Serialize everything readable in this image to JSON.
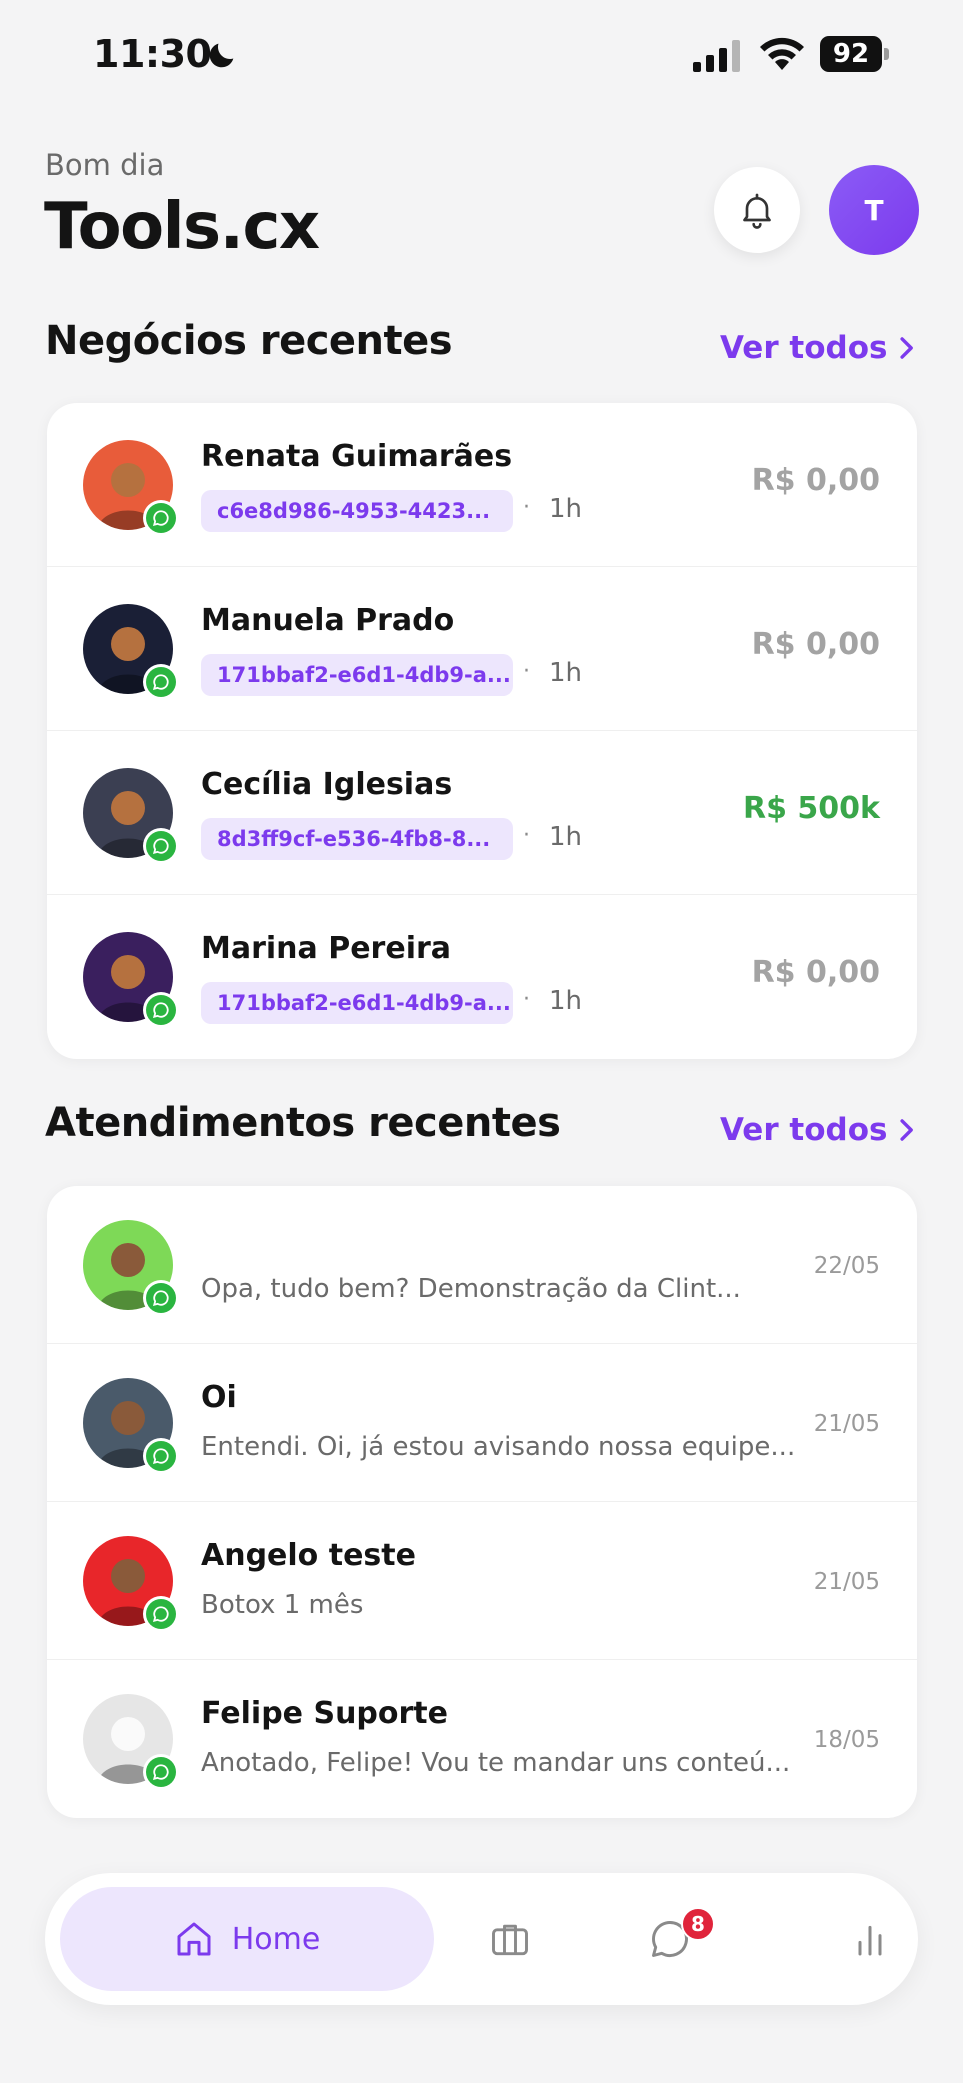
{
  "status_bar": {
    "time": "11:30",
    "battery": "92"
  },
  "header": {
    "greeting": "Bom dia",
    "title": "Tools.cx",
    "avatar_initial": "T"
  },
  "deals": {
    "title": "Negócios recentes",
    "see_all": "Ver todos",
    "items": [
      {
        "name": "Renata Guimarães",
        "tag": "c6e8d986-4953-4423...",
        "time": "1h",
        "value": "R$ 0,00",
        "value_color": "#a3a3a3",
        "avatar_color": "#e85c3a"
      },
      {
        "name": "Manuela Prado",
        "tag": "171bbaf2-e6d1-4db9-a...",
        "time": "1h",
        "value": "R$ 0,00",
        "value_color": "#a3a3a3",
        "avatar_color": "#1a1f36"
      },
      {
        "name": "Cecília Iglesias",
        "tag": "8d3ff9cf-e536-4fb8-8...",
        "time": "1h",
        "value": "R$ 500k",
        "value_color": "#3aa64a",
        "avatar_color": "#3b3f52"
      },
      {
        "name": "Marina Pereira",
        "tag": "171bbaf2-e6d1-4db9-a...",
        "time": "1h",
        "value": "R$ 0,00",
        "value_color": "#a3a3a3",
        "avatar_color": "#3a1f5e"
      }
    ]
  },
  "conversations": {
    "title": "Atendimentos recentes",
    "see_all": "Ver todos",
    "items": [
      {
        "name": "",
        "message": "Opa, tudo bem? Demonstração da Clint...",
        "date": "22/05",
        "avatar_color": "#7ed957"
      },
      {
        "name": "Oi",
        "message": "Entendi. Oi, já estou avisando nossa equipe...",
        "date": "21/05",
        "avatar_color": "#4a5a6a"
      },
      {
        "name": "Angelo teste",
        "message": "Botox 1 mês",
        "date": "21/05",
        "avatar_color": "#e8262a"
      },
      {
        "name": "Felipe Suporte",
        "message": "Anotado, Felipe! Vou te mandar uns conteú...",
        "date": "18/05",
        "avatar_color": "#e6e6e6"
      }
    ]
  },
  "tabbar": {
    "home_label": "Home",
    "chat_badge": "8",
    "icons": [
      "home-icon",
      "briefcase-icon",
      "chat-icon",
      "chart-icon"
    ],
    "accent": "#7c3aed"
  }
}
